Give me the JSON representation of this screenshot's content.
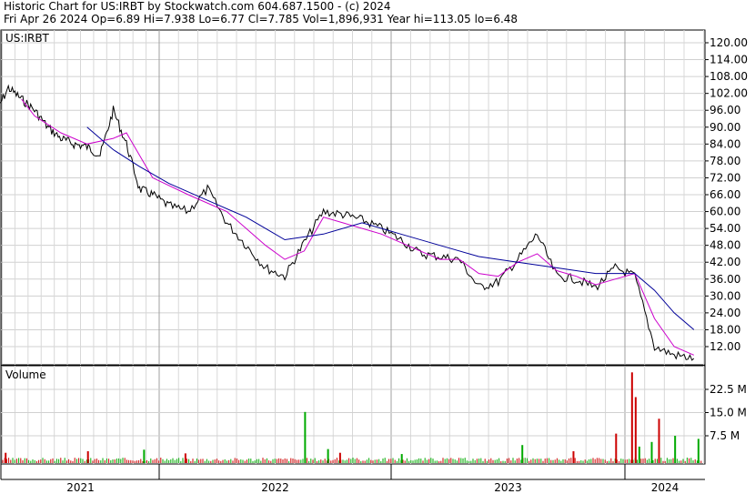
{
  "header": {
    "line1": "Historic Chart for US:IRBT by Stockwatch.com 604.687.1500 - (c) 2024",
    "line2": "Fri Apr 26 2024  Op=6.89  Hi=7.938  Lo=6.77  Cl=7.785  Vol=1,896,931  Year hi=113.05  lo=6.48"
  },
  "chart_data": [
    {
      "type": "line",
      "panel": "price",
      "label": "US:IRBT",
      "x_unit": "month",
      "y_ticks": [
        12,
        18,
        24,
        30,
        36,
        42,
        48,
        54,
        60,
        66,
        72,
        78,
        84,
        90,
        96,
        102,
        108,
        114,
        120
      ],
      "y_tick_labels": [
        "12.00",
        "18.00",
        "24.00",
        "30.00",
        "36.00",
        "42.00",
        "48.00",
        "54.00",
        "60.00",
        "66.00",
        "72.00",
        "78.00",
        "84.00",
        "90.00",
        "96.00",
        "102.00",
        "108.00",
        "114.00",
        "120.00"
      ],
      "ylim": [
        5,
        123
      ],
      "x_ticks": [
        "2021",
        "2022",
        "2023",
        "2024"
      ],
      "grid": true,
      "series": [
        {
          "color": "#000000",
          "style": "price",
          "x": [
            "2020-12",
            "2021-01",
            "2021-02",
            "2021-03",
            "2021-04",
            "2021-05",
            "2021-06",
            "2021-07",
            "2021-08",
            "2021-09",
            "2021-10",
            "2021-11",
            "2021-12",
            "2022-01",
            "2022-02",
            "2022-03",
            "2022-04",
            "2022-05",
            "2022-06",
            "2022-07",
            "2022-08",
            "2022-09",
            "2022-10",
            "2022-11",
            "2022-12",
            "2023-01",
            "2023-02",
            "2023-03",
            "2023-04",
            "2023-05",
            "2023-06",
            "2023-07",
            "2023-08",
            "2023-09",
            "2023-10",
            "2023-11",
            "2023-12",
            "2024-01",
            "2024-02",
            "2024-03",
            "2024-04"
          ],
          "values": [
            95,
            104,
            100,
            96,
            90,
            86,
            84,
            83,
            80,
            96,
            84,
            68,
            66,
            62,
            60,
            68,
            56,
            48,
            40,
            37,
            49,
            60,
            59,
            57,
            54,
            50,
            45,
            44,
            43,
            33,
            35,
            43,
            52,
            37,
            36,
            33,
            40,
            37,
            12,
            9,
            7.8
          ]
        },
        {
          "color": "#cc00cc",
          "style": "short moving average",
          "x": [
            "2021-02",
            "2021-03",
            "2021-05",
            "2021-07",
            "2021-09",
            "2021-10",
            "2021-12",
            "2022-02",
            "2022-04",
            "2022-06",
            "2022-07",
            "2022-08",
            "2022-09",
            "2022-10",
            "2022-12",
            "2023-02",
            "2023-03",
            "2023-04",
            "2023-05",
            "2023-06",
            "2023-07",
            "2023-08",
            "2023-09",
            "2023-10",
            "2023-11",
            "2023-12",
            "2024-01",
            "2024-02",
            "2024-03",
            "2024-04"
          ],
          "values": [
            100,
            94,
            88,
            84,
            86,
            88,
            72,
            66,
            60,
            48,
            43,
            46,
            58,
            56,
            52,
            46,
            43,
            43,
            38,
            37,
            42,
            45,
            39,
            37,
            34,
            36,
            38,
            22,
            12,
            9
          ]
        },
        {
          "color": "#000099",
          "style": "long moving average",
          "x": [
            "2021-07",
            "2021-09",
            "2021-11",
            "2022-01",
            "2022-03",
            "2022-05",
            "2022-07",
            "2022-09",
            "2022-11",
            "2023-01",
            "2023-03",
            "2023-05",
            "2023-07",
            "2023-09",
            "2023-11",
            "2024-01",
            "2024-02",
            "2024-03",
            "2024-04"
          ],
          "values": [
            90,
            82,
            76,
            70,
            64,
            58,
            50,
            52,
            56,
            52,
            48,
            44,
            42,
            40,
            38,
            38,
            32,
            24,
            18
          ]
        }
      ]
    },
    {
      "type": "bar",
      "panel": "volume",
      "label": "Volume",
      "y_ticks": [
        7.5,
        15.0,
        22.5
      ],
      "y_tick_labels": [
        "7.5 M",
        "15.0 M",
        "22.5 M"
      ],
      "ylim": [
        0,
        28
      ],
      "x_ticks": [
        "2021",
        "2022",
        "2023",
        "2024"
      ],
      "colors": {
        "up": "#00aa00",
        "down": "#cc0000"
      },
      "spikes": [
        {
          "x": "2021-01",
          "value": 2.0,
          "color": "down"
        },
        {
          "x": "2021-07",
          "value": 2.5,
          "color": "down"
        },
        {
          "x": "2021-11",
          "value": 3.0,
          "color": "up"
        },
        {
          "x": "2022-02",
          "value": 1.8,
          "color": "down"
        },
        {
          "x": "2022-08",
          "value": 15.2,
          "color": "up"
        },
        {
          "x": "2022-09",
          "value": 3.2,
          "color": "up"
        },
        {
          "x": "2022-10",
          "value": 2.0,
          "color": "down"
        },
        {
          "x": "2023-01",
          "value": 1.6,
          "color": "up"
        },
        {
          "x": "2023-07",
          "value": 4.5,
          "color": "up"
        },
        {
          "x": "2023-10",
          "value": 2.5,
          "color": "down"
        },
        {
          "x": "2023-12",
          "value": 8.2,
          "color": "down"
        },
        {
          "x": "2024-01",
          "value": 4.0,
          "color": "up"
        },
        {
          "x": "2024-01",
          "value": 28.0,
          "color": "down"
        },
        {
          "x": "2024-01",
          "value": 20.0,
          "color": "down"
        },
        {
          "x": "2024-02",
          "value": 13.0,
          "color": "down"
        },
        {
          "x": "2024-02",
          "value": 5.5,
          "color": "up"
        },
        {
          "x": "2024-03",
          "value": 7.5,
          "color": "up"
        },
        {
          "x": "2024-04",
          "value": 6.5,
          "color": "up"
        }
      ]
    }
  ]
}
